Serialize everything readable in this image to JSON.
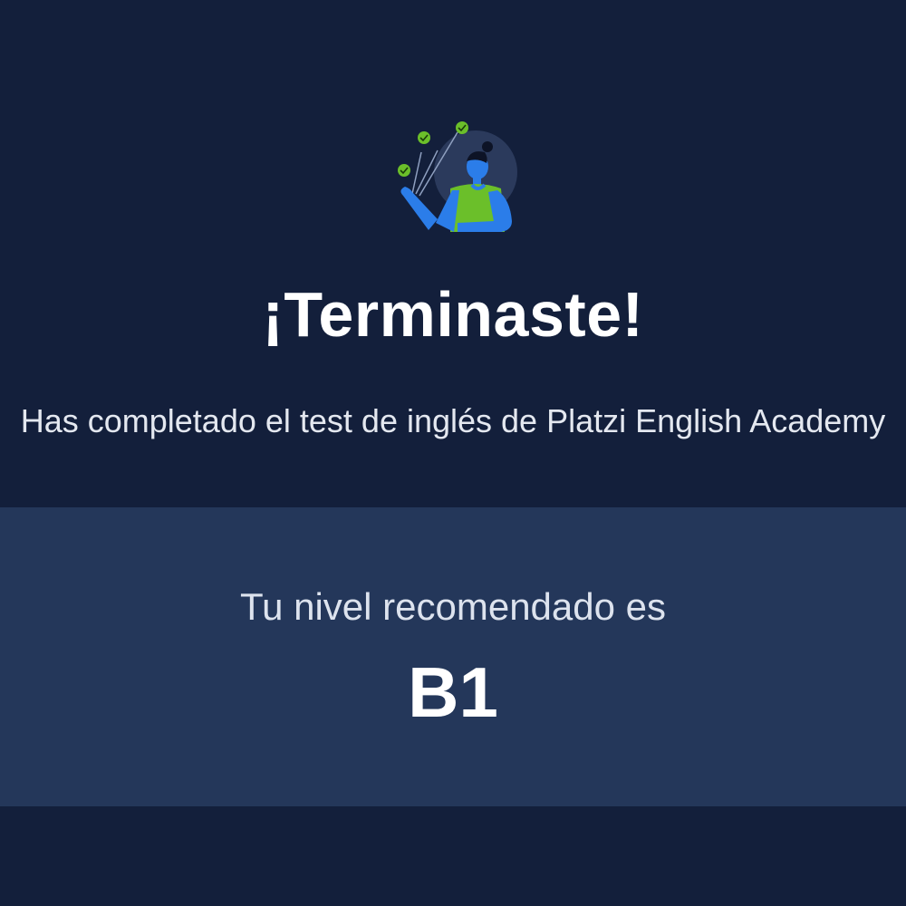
{
  "completion": {
    "title": "¡Terminaste!",
    "subtitle": "Has completado el test de inglés de Platzi English Academy"
  },
  "result": {
    "label": "Tu nivel recomendado es",
    "level": "B1"
  },
  "colors": {
    "background": "#131f3b",
    "card": "#24375a",
    "accent_green": "#6bbf2a",
    "figure_blue": "#2b7de9"
  },
  "icons": {
    "illustration": "celebrating-person-with-checkmarks-icon"
  }
}
